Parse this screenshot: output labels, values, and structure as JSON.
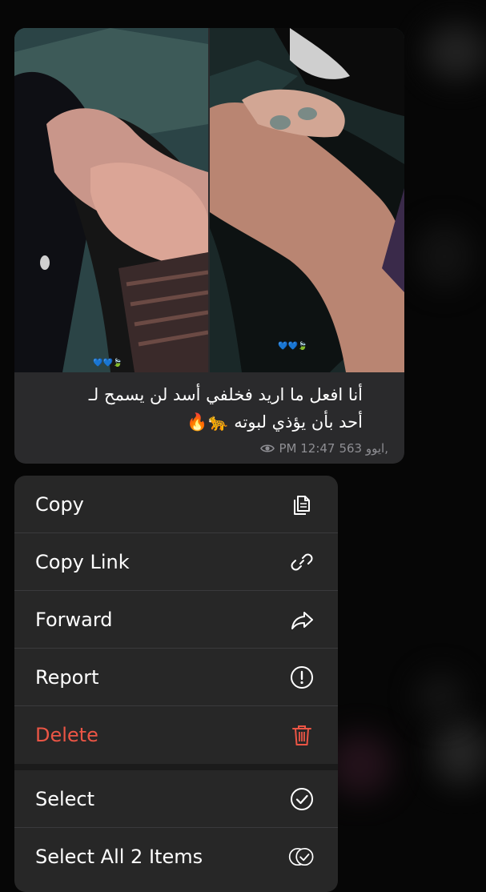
{
  "message": {
    "caption_line1": "أنا افعل ما اريد فخلفي أسد لن يسمح لـ",
    "caption_line2": "أحد بأن يؤذي لبوته 🐆🔥",
    "time": "PM 12:47",
    "views": "563 ايوو,",
    "photo_left_overlay": "💙💙🍃",
    "photo_right_overlay": "💙💙🍃"
  },
  "menu": {
    "items": [
      {
        "label": "Copy",
        "icon": "copy-icon"
      },
      {
        "label": "Copy Link",
        "icon": "link-icon"
      },
      {
        "label": "Forward",
        "icon": "forward-icon"
      },
      {
        "label": "Report",
        "icon": "report-icon"
      },
      {
        "label": "Delete",
        "icon": "trash-icon"
      },
      {
        "label": "Select",
        "icon": "select-check-icon"
      },
      {
        "label": "Select All 2 Items",
        "icon": "select-all-icon"
      }
    ]
  },
  "colors": {
    "menu_bg": "#272727",
    "bubble_bg": "#2a2a2c",
    "danger": "#eb5545",
    "meta_text": "#8e8e93"
  }
}
